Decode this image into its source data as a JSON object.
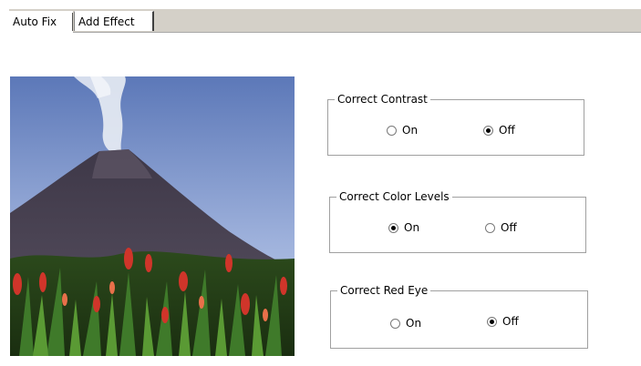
{
  "tabs": [
    {
      "label": "Auto Fix",
      "active": true
    },
    {
      "label": "Add Effect",
      "active": false
    }
  ],
  "image": {
    "subject": "volcano-with-flowers"
  },
  "groups": [
    {
      "title": "Correct Contrast",
      "options": [
        {
          "label": "On",
          "checked": false
        },
        {
          "label": "Off",
          "checked": true
        }
      ]
    },
    {
      "title": "Correct Color Levels",
      "options": [
        {
          "label": "On",
          "checked": true
        },
        {
          "label": "Off",
          "checked": false
        }
      ]
    },
    {
      "title": "Correct Red Eye",
      "options": [
        {
          "label": "On",
          "checked": false
        },
        {
          "label": "Off",
          "checked": true
        }
      ]
    }
  ],
  "colors": {
    "tabstrip_bg": "#d4d0c8",
    "groupbox_border": "#a0a0a0",
    "sky": "#7f98c8",
    "mountain": "#4b4350"
  }
}
